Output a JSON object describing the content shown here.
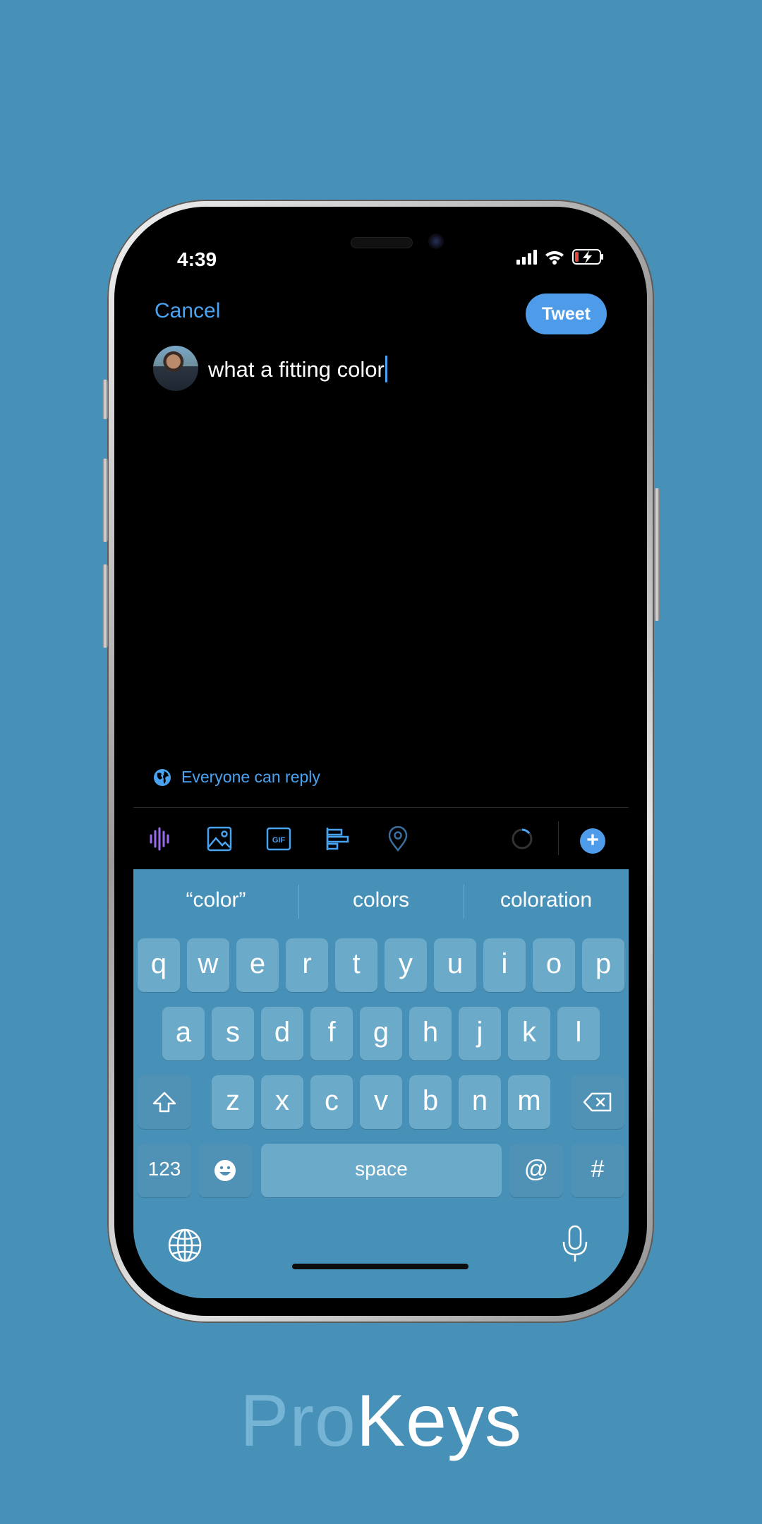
{
  "status_bar": {
    "time": "4:39"
  },
  "compose": {
    "cancel_label": "Cancel",
    "tweet_label": "Tweet",
    "text": "what a fitting color",
    "reply_setting": "Everyone can reply"
  },
  "toolbar": {
    "icons": [
      "audio-waveform-icon",
      "image-icon",
      "gif-icon",
      "poll-icon",
      "location-pin-icon",
      "character-progress-icon",
      "add-thread-icon"
    ],
    "gif_label": "GIF",
    "plus_label": "+"
  },
  "keyboard": {
    "suggestions": [
      "“color”",
      "colors",
      "coloration"
    ],
    "row1": [
      "q",
      "w",
      "e",
      "r",
      "t",
      "y",
      "u",
      "i",
      "o",
      "p"
    ],
    "row2": [
      "a",
      "s",
      "d",
      "f",
      "g",
      "h",
      "j",
      "k",
      "l"
    ],
    "row3": [
      "z",
      "x",
      "c",
      "v",
      "b",
      "n",
      "m"
    ],
    "numbers_label": "123",
    "space_label": "space",
    "at_label": "@",
    "hash_label": "#"
  },
  "branding": {
    "pro": "Pro",
    "keys": "Keys"
  },
  "colors": {
    "background": "#4790b7",
    "accent": "#4d9be9",
    "screen": "#000000"
  }
}
